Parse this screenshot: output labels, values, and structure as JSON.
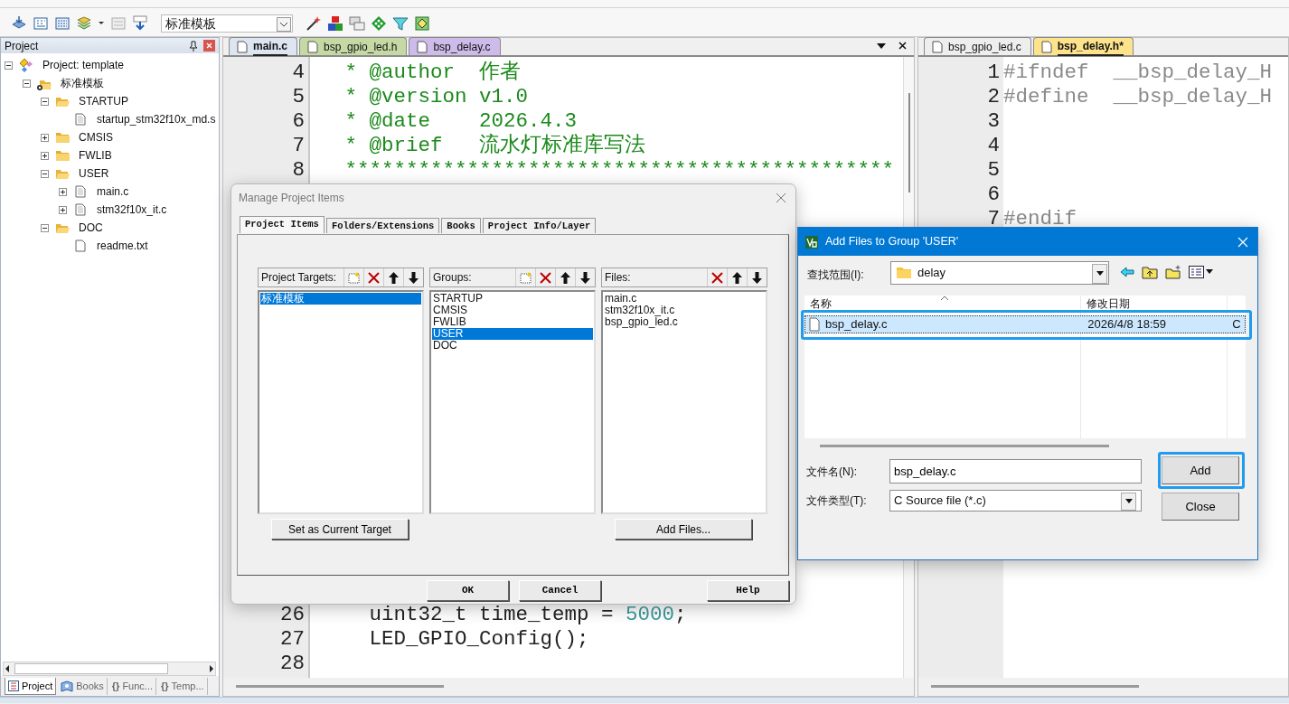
{
  "toolbar": {
    "target_select": {
      "value": "标准模板"
    }
  },
  "project_panel": {
    "title": "Project",
    "tree": [
      {
        "label": "Project: template",
        "kind": "project",
        "expanded": true,
        "children": [
          {
            "label": "标准模板",
            "kind": "target",
            "expanded": true,
            "children": [
              {
                "label": "STARTUP",
                "kind": "folder",
                "expanded": true,
                "children": [
                  {
                    "label": "startup_stm32f10x_md.s",
                    "kind": "file"
                  }
                ]
              },
              {
                "label": "CMSIS",
                "kind": "folder",
                "expanded": false
              },
              {
                "label": "FWLIB",
                "kind": "folder",
                "expanded": false
              },
              {
                "label": "USER",
                "kind": "folder",
                "expanded": true,
                "children": [
                  {
                    "label": "main.c",
                    "kind": "file",
                    "expanded": false
                  },
                  {
                    "label": "stm32f10x_it.c",
                    "kind": "file",
                    "expanded": false
                  }
                ]
              },
              {
                "label": "DOC",
                "kind": "folder",
                "expanded": true,
                "children": [
                  {
                    "label": "readme.txt",
                    "kind": "text"
                  }
                ]
              }
            ]
          }
        ]
      }
    ],
    "bottom_tabs": [
      {
        "label": "Project",
        "kind": "project",
        "selected": true
      },
      {
        "label": "Books",
        "kind": "books",
        "selected": false
      },
      {
        "label": "Func...",
        "kind": "functions",
        "glyph": "{}",
        "selected": false
      },
      {
        "label": "Temp...",
        "kind": "templates",
        "glyph": "{}",
        "selected": false
      }
    ]
  },
  "editors": [
    {
      "tabs": [
        {
          "label": "main.c",
          "selected": true,
          "color": "#dde5f1"
        },
        {
          "label": "bsp_gpio_led.h",
          "selected": false,
          "color": "#c6d9a5"
        },
        {
          "label": "bsp_delay.c",
          "selected": false,
          "color": "#cdbbea"
        }
      ],
      "code_blocks": [
        {
          "lines": [
            {
              "number": "4",
              "segments": [
                {
                  "kind": "comment",
                  "text": "   * @author  作者"
                }
              ]
            },
            {
              "number": "5",
              "segments": [
                {
                  "kind": "comment",
                  "text": "   * @version v1.0"
                }
              ]
            },
            {
              "number": "6",
              "segments": [
                {
                  "kind": "comment",
                  "text": "   * @date    2026.4.3"
                }
              ]
            },
            {
              "number": "7",
              "segments": [
                {
                  "kind": "comment",
                  "text": "   * @brief   流水灯标准库写法"
                }
              ]
            },
            {
              "number": "8",
              "segments": [
                {
                  "kind": "comment",
                  "text": "   *********************************************"
                }
              ]
            }
          ]
        },
        {
          "lines": [
            {
              "number": "26",
              "segments": [
                {
                  "kind": "plain",
                  "text": "     uint32_t time_temp = "
                },
                {
                  "kind": "number",
                  "text": "5000"
                },
                {
                  "kind": "plain",
                  "text": ";"
                }
              ]
            },
            {
              "number": "27",
              "segments": [
                {
                  "kind": "plain",
                  "text": "     LED_GPIO_Config();"
                }
              ]
            },
            {
              "number": "28"
            }
          ]
        }
      ]
    },
    {
      "tabs": [
        {
          "label": "bsp_gpio_led.c",
          "selected": false,
          "color": "#eeeeee"
        },
        {
          "label": "bsp_delay.h*",
          "selected": true,
          "color": "#fde38c"
        }
      ],
      "code_blocks": [
        {
          "lines": [
            {
              "number": "1",
              "segments": [
                {
                  "kind": "preprocessor",
                  "text": "#ifndef  __bsp_delay_H"
                }
              ]
            },
            {
              "number": "2",
              "segments": [
                {
                  "kind": "preprocessor",
                  "text": "#define  __bsp_delay_H"
                }
              ]
            },
            {
              "number": "3"
            },
            {
              "number": "4"
            },
            {
              "number": "5"
            },
            {
              "number": "6"
            },
            {
              "number": "7",
              "segments": [
                {
                  "kind": "preprocessor",
                  "text": "#endif"
                }
              ]
            }
          ]
        }
      ]
    }
  ],
  "manage_dialog": {
    "title": "Manage Project Items",
    "tabs": [
      {
        "label": "Project Items",
        "selected": true
      },
      {
        "label": "Folders/Extensions",
        "selected": false
      },
      {
        "label": "Books",
        "selected": false
      },
      {
        "label": "Project Info/Layer",
        "selected": false
      }
    ],
    "panels": [
      {
        "title": "Project Targets:",
        "tools": [
          {
            "kind": "new"
          },
          {
            "kind": "delete"
          },
          {
            "kind": "up"
          },
          {
            "kind": "down"
          }
        ],
        "items": [
          {
            "label": "标准模板",
            "selected": true
          }
        ],
        "button": "Set as Current Target"
      },
      {
        "title": "Groups:",
        "tools": [
          {
            "kind": "new"
          },
          {
            "kind": "delete"
          },
          {
            "kind": "up"
          },
          {
            "kind": "down"
          }
        ],
        "items": [
          {
            "label": "STARTUP",
            "selected": false
          },
          {
            "label": "CMSIS",
            "selected": false
          },
          {
            "label": "FWLIB",
            "selected": false
          },
          {
            "label": "USER",
            "selected": true
          },
          {
            "label": "DOC",
            "selected": false
          }
        ]
      },
      {
        "title": "Files:",
        "tools": [
          {
            "kind": "delete"
          },
          {
            "kind": "up"
          },
          {
            "kind": "down"
          }
        ],
        "items": [
          {
            "label": "main.c",
            "selected": false
          },
          {
            "label": "stm32f10x_it.c",
            "selected": false
          },
          {
            "label": "bsp_gpio_led.c",
            "selected": false
          }
        ],
        "button": "Add Files..."
      }
    ],
    "buttons": [
      {
        "label": "OK",
        "kind": "action"
      },
      {
        "label": "Cancel",
        "kind": "action"
      },
      {
        "label": "Help",
        "kind": "help"
      }
    ]
  },
  "add_files_dialog": {
    "title": "Add Files to Group 'USER'",
    "look_in": {
      "label": "查找范围(I):",
      "value": "delay"
    },
    "columns": [
      "名称",
      "修改日期"
    ],
    "rows": [
      {
        "cells": [
          "bsp_delay.c",
          "2026/4/8 18:59",
          "C"
        ],
        "selected": true,
        "annotated": true
      }
    ],
    "file_name": {
      "label": "文件名(N):",
      "value": "bsp_delay.c"
    },
    "file_type": {
      "label": "文件类型(T):",
      "value": "C Source file (*.c)"
    },
    "buttons": [
      {
        "label": "Add",
        "annotated": true
      },
      {
        "label": "Close",
        "annotated": false
      }
    ]
  }
}
